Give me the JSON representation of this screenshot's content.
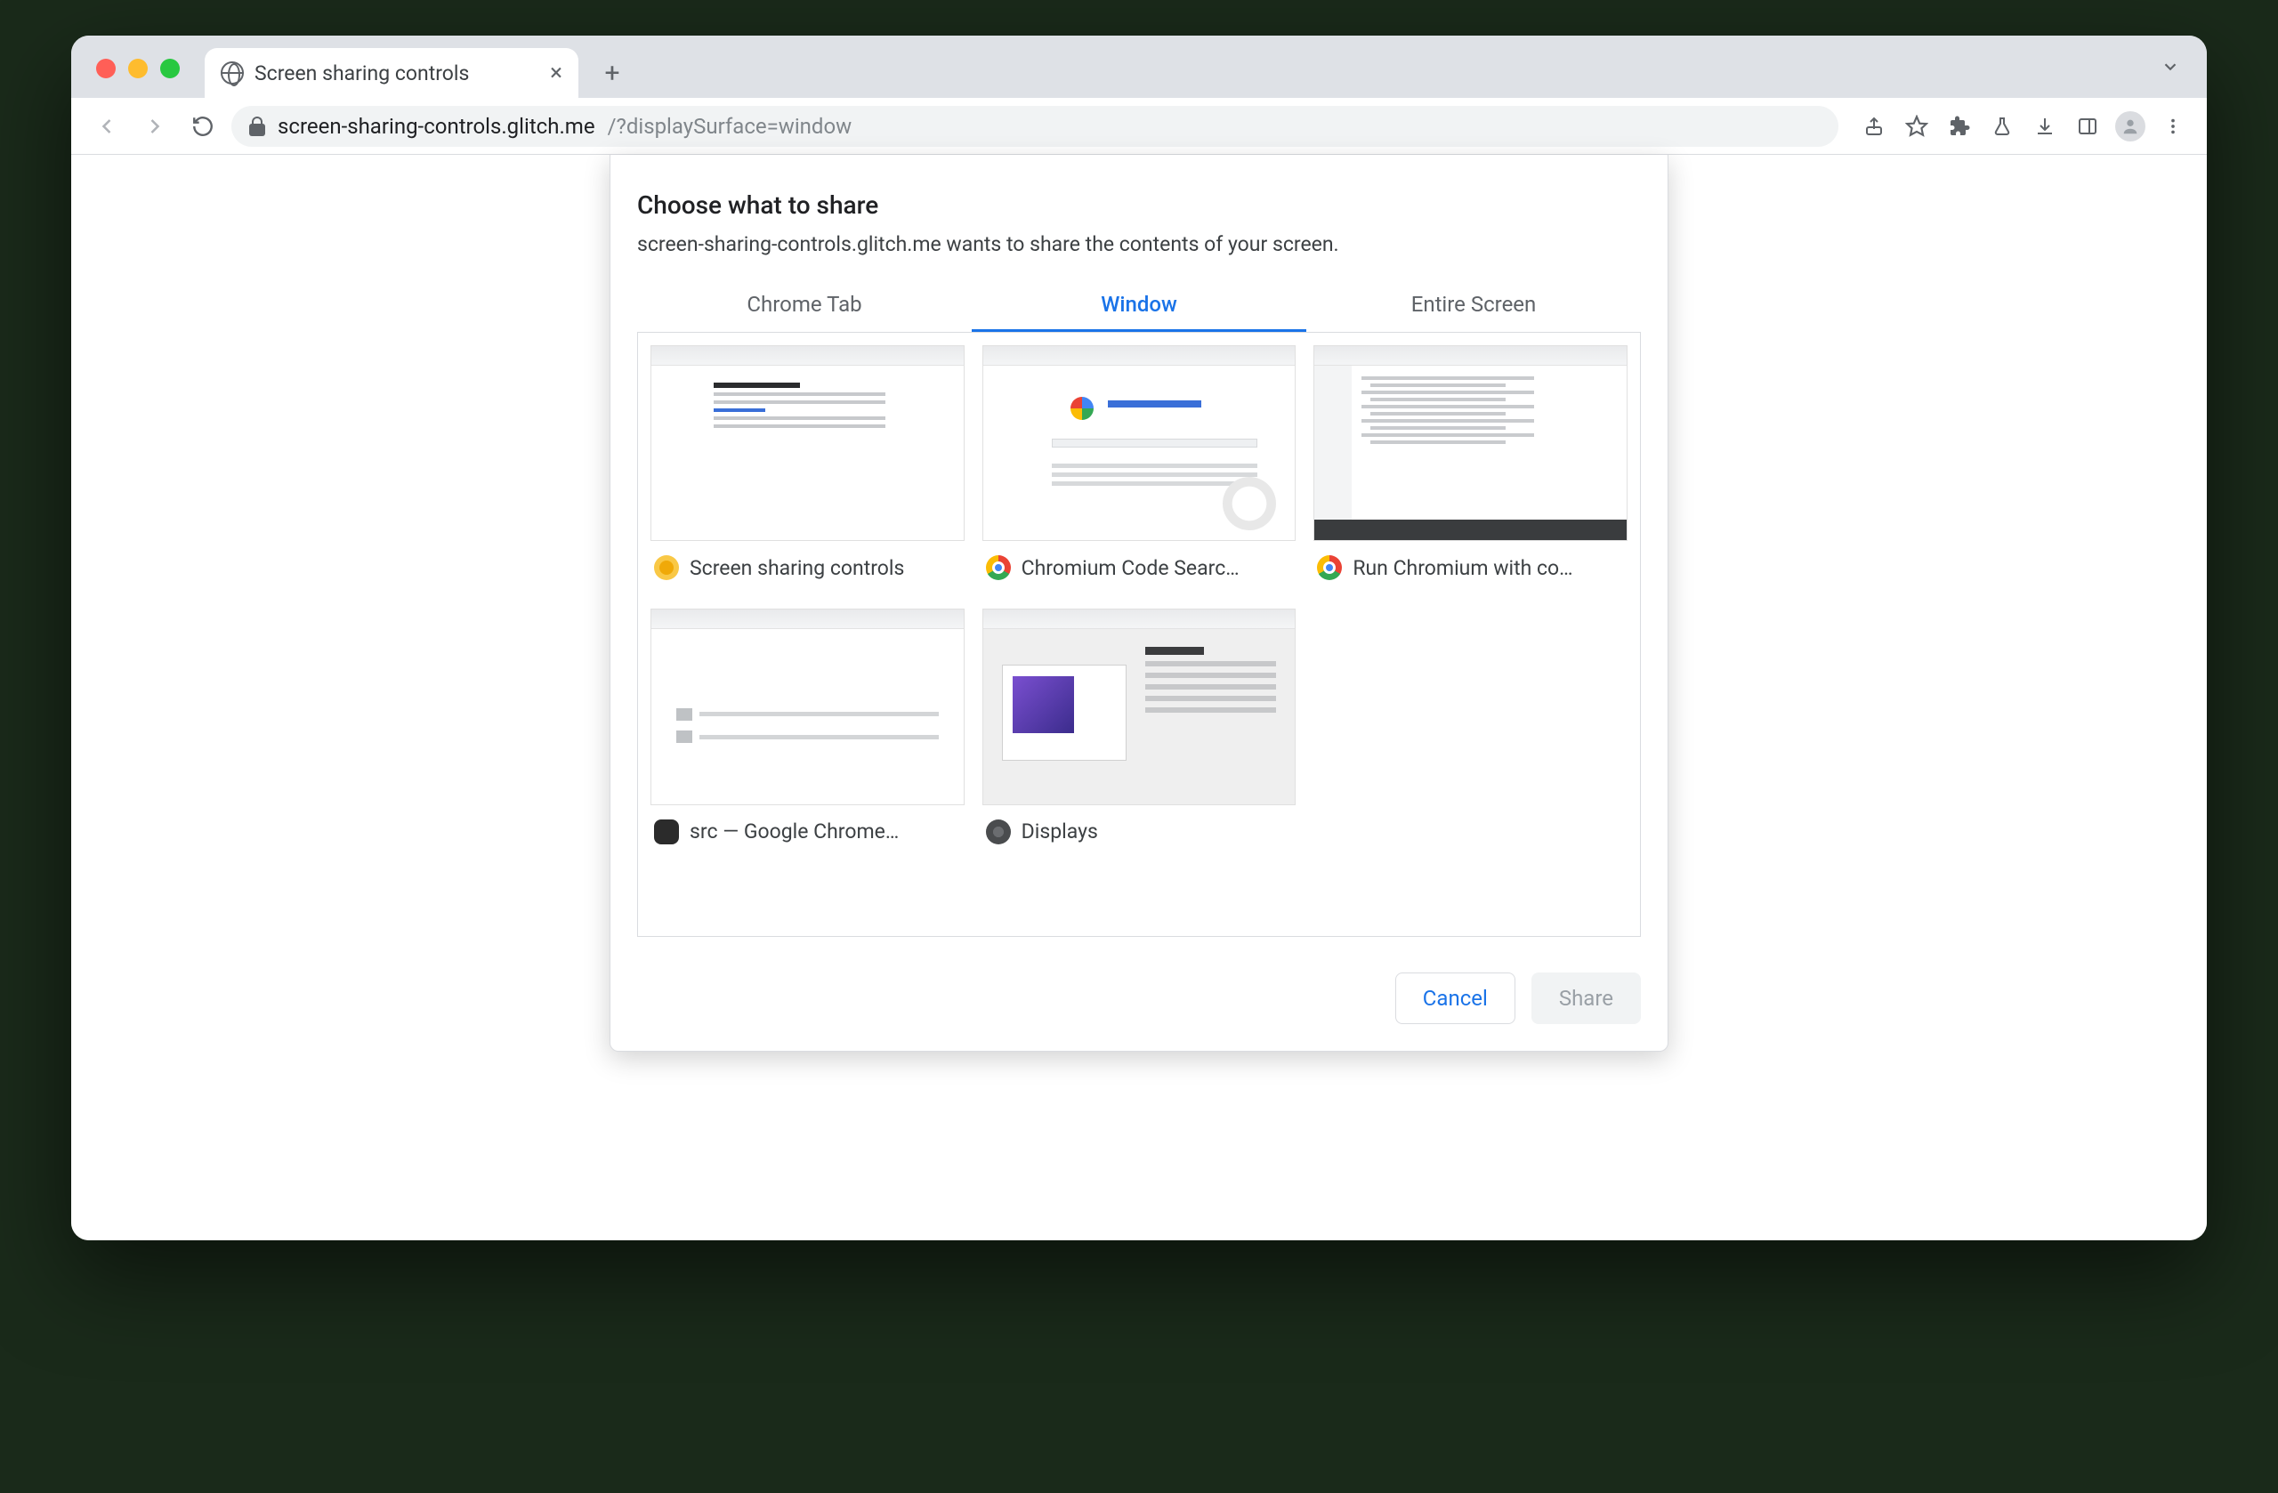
{
  "browser_tab": {
    "title": "Screen sharing controls"
  },
  "address_bar": {
    "host": "screen-sharing-controls.glitch.me",
    "path": "/?displaySurface=window"
  },
  "modal": {
    "title": "Choose what to share",
    "subtitle": "screen-sharing-controls.glitch.me wants to share the contents of your screen.",
    "tabs": {
      "chrome_tab": "Chrome Tab",
      "window": "Window",
      "entire_screen": "Entire Screen"
    },
    "active_tab": "window",
    "windows": [
      {
        "label": "Screen sharing controls",
        "icon": "canary"
      },
      {
        "label": "Chromium Code Searc…",
        "icon": "chrome"
      },
      {
        "label": "Run Chromium with co…",
        "icon": "chrome"
      },
      {
        "label": "src — Google Chrome…",
        "icon": "term"
      },
      {
        "label": "Displays",
        "icon": "sys"
      }
    ],
    "buttons": {
      "cancel": "Cancel",
      "share": "Share"
    }
  }
}
